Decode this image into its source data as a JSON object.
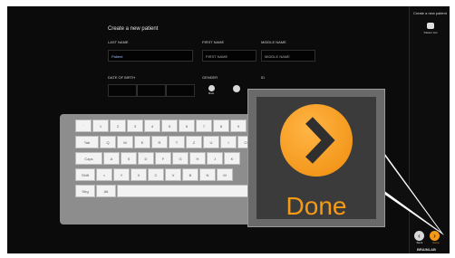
{
  "sidebar": {
    "title": "Create a new patient",
    "patient_list": "Patient List",
    "back": "Back",
    "done": "Done",
    "brand": "BRAINLAB"
  },
  "form": {
    "title": "Create a new patient",
    "last_name_label": "LAST NAME",
    "last_name_value": "Patient",
    "first_name_label": "FIRST NAME",
    "first_name_placeholder": "FIRST NAME",
    "middle_name_label": "MIDDLE NAME",
    "middle_name_placeholder": "MIDDLE NAME",
    "dob_label": "DATE OF BIRTH",
    "gender_label": "GENDER",
    "gender_male": "Male",
    "id_label": "ID"
  },
  "keyboard": {
    "row1": [
      "`",
      "1",
      "2",
      "3",
      "4",
      "5",
      "6",
      "7",
      "8",
      "9",
      "0"
    ],
    "row2": [
      "Tab",
      "Q",
      "W",
      "E",
      "R",
      "T",
      "Z",
      "U",
      "I",
      "O"
    ],
    "row3": [
      "Caps",
      "A",
      "S",
      "D",
      "F",
      "G",
      "H",
      "J",
      "K"
    ],
    "row4": [
      "Shift",
      "<",
      "Y",
      "X",
      "C",
      "V",
      "B",
      "N",
      "M"
    ],
    "row5": [
      "Strg",
      "Alt"
    ]
  },
  "zoom": {
    "label": "Done"
  },
  "colors": {
    "accent": "#f39a17",
    "background": "#0b0b0b",
    "keyboard": "#8d8d8d"
  }
}
